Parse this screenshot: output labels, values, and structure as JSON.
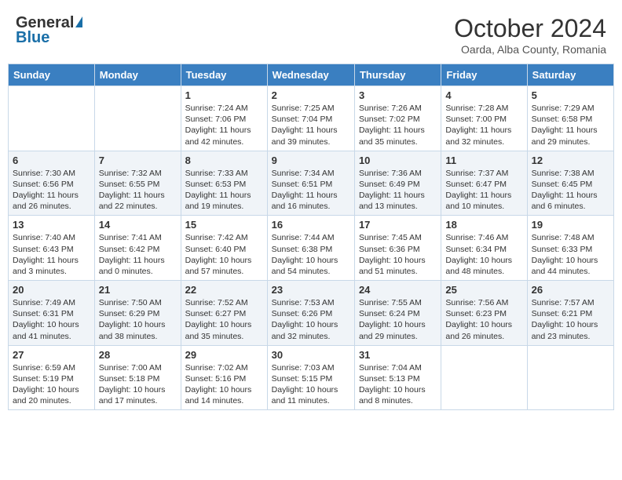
{
  "header": {
    "logo_general": "General",
    "logo_blue": "Blue",
    "month_title": "October 2024",
    "location": "Oarda, Alba County, Romania"
  },
  "days_of_week": [
    "Sunday",
    "Monday",
    "Tuesday",
    "Wednesday",
    "Thursday",
    "Friday",
    "Saturday"
  ],
  "weeks": [
    [
      {
        "day": "",
        "text": ""
      },
      {
        "day": "",
        "text": ""
      },
      {
        "day": "1",
        "text": "Sunrise: 7:24 AM\nSunset: 7:06 PM\nDaylight: 11 hours and 42 minutes."
      },
      {
        "day": "2",
        "text": "Sunrise: 7:25 AM\nSunset: 7:04 PM\nDaylight: 11 hours and 39 minutes."
      },
      {
        "day": "3",
        "text": "Sunrise: 7:26 AM\nSunset: 7:02 PM\nDaylight: 11 hours and 35 minutes."
      },
      {
        "day": "4",
        "text": "Sunrise: 7:28 AM\nSunset: 7:00 PM\nDaylight: 11 hours and 32 minutes."
      },
      {
        "day": "5",
        "text": "Sunrise: 7:29 AM\nSunset: 6:58 PM\nDaylight: 11 hours and 29 minutes."
      }
    ],
    [
      {
        "day": "6",
        "text": "Sunrise: 7:30 AM\nSunset: 6:56 PM\nDaylight: 11 hours and 26 minutes."
      },
      {
        "day": "7",
        "text": "Sunrise: 7:32 AM\nSunset: 6:55 PM\nDaylight: 11 hours and 22 minutes."
      },
      {
        "day": "8",
        "text": "Sunrise: 7:33 AM\nSunset: 6:53 PM\nDaylight: 11 hours and 19 minutes."
      },
      {
        "day": "9",
        "text": "Sunrise: 7:34 AM\nSunset: 6:51 PM\nDaylight: 11 hours and 16 minutes."
      },
      {
        "day": "10",
        "text": "Sunrise: 7:36 AM\nSunset: 6:49 PM\nDaylight: 11 hours and 13 minutes."
      },
      {
        "day": "11",
        "text": "Sunrise: 7:37 AM\nSunset: 6:47 PM\nDaylight: 11 hours and 10 minutes."
      },
      {
        "day": "12",
        "text": "Sunrise: 7:38 AM\nSunset: 6:45 PM\nDaylight: 11 hours and 6 minutes."
      }
    ],
    [
      {
        "day": "13",
        "text": "Sunrise: 7:40 AM\nSunset: 6:43 PM\nDaylight: 11 hours and 3 minutes."
      },
      {
        "day": "14",
        "text": "Sunrise: 7:41 AM\nSunset: 6:42 PM\nDaylight: 11 hours and 0 minutes."
      },
      {
        "day": "15",
        "text": "Sunrise: 7:42 AM\nSunset: 6:40 PM\nDaylight: 10 hours and 57 minutes."
      },
      {
        "day": "16",
        "text": "Sunrise: 7:44 AM\nSunset: 6:38 PM\nDaylight: 10 hours and 54 minutes."
      },
      {
        "day": "17",
        "text": "Sunrise: 7:45 AM\nSunset: 6:36 PM\nDaylight: 10 hours and 51 minutes."
      },
      {
        "day": "18",
        "text": "Sunrise: 7:46 AM\nSunset: 6:34 PM\nDaylight: 10 hours and 48 minutes."
      },
      {
        "day": "19",
        "text": "Sunrise: 7:48 AM\nSunset: 6:33 PM\nDaylight: 10 hours and 44 minutes."
      }
    ],
    [
      {
        "day": "20",
        "text": "Sunrise: 7:49 AM\nSunset: 6:31 PM\nDaylight: 10 hours and 41 minutes."
      },
      {
        "day": "21",
        "text": "Sunrise: 7:50 AM\nSunset: 6:29 PM\nDaylight: 10 hours and 38 minutes."
      },
      {
        "day": "22",
        "text": "Sunrise: 7:52 AM\nSunset: 6:27 PM\nDaylight: 10 hours and 35 minutes."
      },
      {
        "day": "23",
        "text": "Sunrise: 7:53 AM\nSunset: 6:26 PM\nDaylight: 10 hours and 32 minutes."
      },
      {
        "day": "24",
        "text": "Sunrise: 7:55 AM\nSunset: 6:24 PM\nDaylight: 10 hours and 29 minutes."
      },
      {
        "day": "25",
        "text": "Sunrise: 7:56 AM\nSunset: 6:23 PM\nDaylight: 10 hours and 26 minutes."
      },
      {
        "day": "26",
        "text": "Sunrise: 7:57 AM\nSunset: 6:21 PM\nDaylight: 10 hours and 23 minutes."
      }
    ],
    [
      {
        "day": "27",
        "text": "Sunrise: 6:59 AM\nSunset: 5:19 PM\nDaylight: 10 hours and 20 minutes."
      },
      {
        "day": "28",
        "text": "Sunrise: 7:00 AM\nSunset: 5:18 PM\nDaylight: 10 hours and 17 minutes."
      },
      {
        "day": "29",
        "text": "Sunrise: 7:02 AM\nSunset: 5:16 PM\nDaylight: 10 hours and 14 minutes."
      },
      {
        "day": "30",
        "text": "Sunrise: 7:03 AM\nSunset: 5:15 PM\nDaylight: 10 hours and 11 minutes."
      },
      {
        "day": "31",
        "text": "Sunrise: 7:04 AM\nSunset: 5:13 PM\nDaylight: 10 hours and 8 minutes."
      },
      {
        "day": "",
        "text": ""
      },
      {
        "day": "",
        "text": ""
      }
    ]
  ]
}
